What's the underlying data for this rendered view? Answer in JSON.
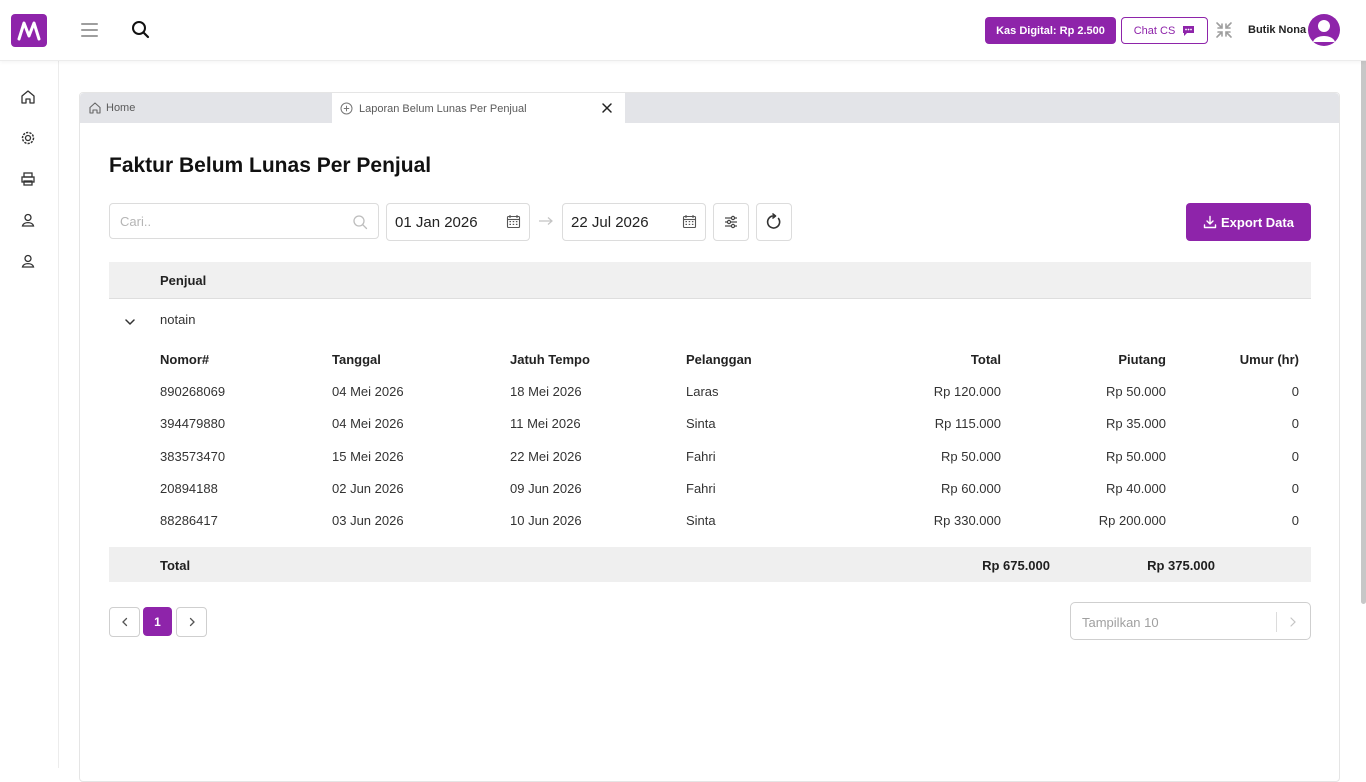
{
  "header": {
    "kas_digital": "Kas Digital: Rp 2.500",
    "chat_cs": "Chat CS",
    "user_name": "Butik Nona",
    "colors": {
      "brand": "#8e24aa"
    }
  },
  "sidebar": {
    "items": [
      {
        "name": "home-icon"
      },
      {
        "name": "settings-icon"
      },
      {
        "name": "printer-icon"
      },
      {
        "name": "user-icon"
      },
      {
        "name": "user-icon"
      }
    ]
  },
  "tabs": [
    {
      "label": "Home"
    },
    {
      "label": "Laporan Belum Lunas Per Penjual"
    }
  ],
  "page": {
    "title": "Faktur Belum Lunas Per Penjual",
    "search_placeholder": "Cari..",
    "date_from": "01 Jan 2026",
    "date_to": "22 Jul 2026",
    "export_label": "Export Data"
  },
  "table": {
    "group_header": "Penjual",
    "group": {
      "name": "notain",
      "columns": [
        "Nomor#",
        "Tanggal",
        "Jatuh Tempo",
        "Pelanggan",
        "Total",
        "Piutang",
        "Umur (hr)"
      ],
      "rows": [
        [
          "890268069",
          "04 Mei 2026",
          "18 Mei 2026",
          "Laras",
          "Rp 120.000",
          "Rp 50.000",
          "0"
        ],
        [
          "394479880",
          "04 Mei 2026",
          "11 Mei 2026",
          "Sinta",
          "Rp 115.000",
          "Rp 35.000",
          "0"
        ],
        [
          "383573470",
          "15 Mei 2026",
          "22 Mei 2026",
          "Fahri",
          "Rp 50.000",
          "Rp 50.000",
          "0"
        ],
        [
          "20894188",
          "02 Jun 2026",
          "09 Jun 2026",
          "Fahri",
          "Rp 60.000",
          "Rp 40.000",
          "0"
        ],
        [
          "88286417",
          "03 Jun 2026",
          "10 Jun 2026",
          "Sinta",
          "Rp 330.000",
          "Rp 200.000",
          "0"
        ]
      ]
    },
    "footer": {
      "label": "Total",
      "total": "Rp 675.000",
      "piutang": "Rp 375.000"
    }
  },
  "pagination": {
    "current_page": "1",
    "page_size_label": "Tampilkan 10"
  }
}
